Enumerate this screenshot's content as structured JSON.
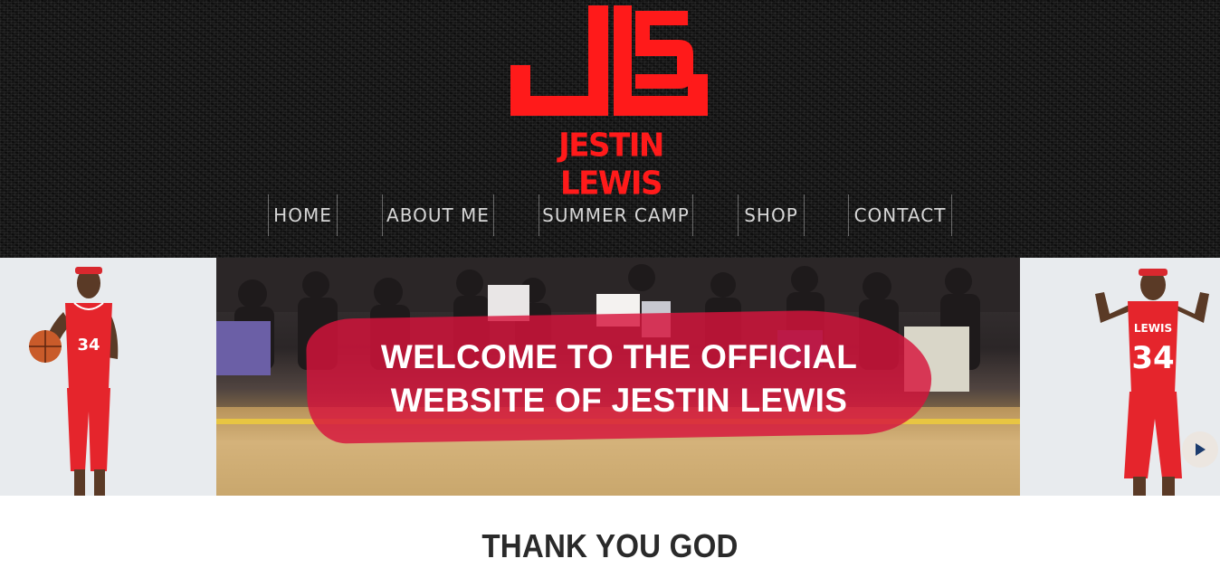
{
  "brand": {
    "name": "JESTIN LEWIS",
    "logo_mark": "J5",
    "accent_color": "#ff1a1a"
  },
  "nav": {
    "items": [
      {
        "label": "HOME"
      },
      {
        "label": "ABOUT ME"
      },
      {
        "label": "SUMMER CAMP"
      },
      {
        "label": "SHOP"
      },
      {
        "label": "CONTACT"
      }
    ]
  },
  "hero": {
    "welcome_line1": "WELCOME TO THE OFFICIAL",
    "welcome_line2": "WEBSITE OF JESTIN LEWIS",
    "left_jersey_number": "34",
    "right_jersey_name": "LEWIS",
    "right_jersey_number": "34",
    "overlay_color": "#d7143c"
  },
  "main": {
    "heading": "THANK YOU GOD"
  }
}
